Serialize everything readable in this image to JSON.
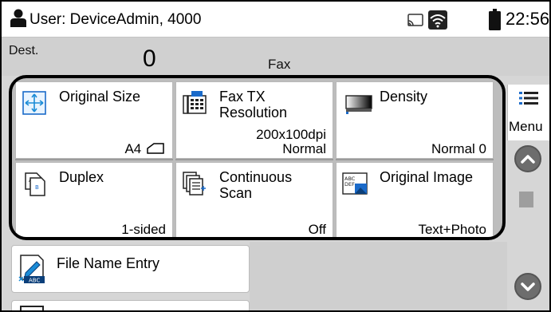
{
  "status": {
    "user_label": "User: DeviceAdmin, 4000",
    "time": "22:56",
    "icons": [
      "user-icon",
      "cast-icon",
      "wifi-icon",
      "battery-icon"
    ]
  },
  "dest": {
    "label": "Dest.",
    "count": "0",
    "mode": "Fax"
  },
  "tiles": [
    {
      "title": "Original Size",
      "value": "A4",
      "icon": "original-size-icon"
    },
    {
      "title": "Fax TX\nResolution",
      "value": "200x100dpi\nNormal",
      "icon": "fax-resolution-icon"
    },
    {
      "title": "Density",
      "value": "Normal 0",
      "icon": "density-icon"
    },
    {
      "title": "Duplex",
      "value": "1-sided",
      "icon": "duplex-icon"
    },
    {
      "title": "Continuous\nScan",
      "value": "Off",
      "icon": "continuous-scan-icon"
    },
    {
      "title": "Original Image",
      "value": "Text+Photo",
      "icon": "original-image-icon"
    }
  ],
  "side": {
    "menu_label": "Menu"
  },
  "lower": {
    "file_name_label": "File Name Entry"
  },
  "colors": {
    "frame": "#000000",
    "background": "#d6d6d6",
    "tile": "#ffffff",
    "scroll_button": "#6d6d6d"
  }
}
